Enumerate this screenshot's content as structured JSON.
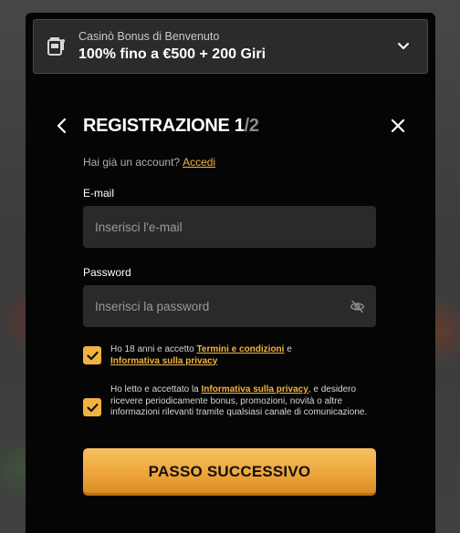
{
  "bonus": {
    "subtitle": "Casinò Bonus di Benvenuto",
    "title": "100% fino a €500 + 200 Giri",
    "icon": "slot-machine-icon"
  },
  "header": {
    "title_main": "REGISTRAZIONE 1",
    "title_total": "/2"
  },
  "login": {
    "prompt": "Hai già un account?",
    "link": "Accedi"
  },
  "email": {
    "label": "E-mail",
    "placeholder": "Inserisci l'e-mail",
    "value": ""
  },
  "password": {
    "label": "Password",
    "placeholder": "Inserisci la password",
    "value": ""
  },
  "consents": [
    {
      "checked": true,
      "text_before": "Ho 18 anni e accetto ",
      "link1": "Termini e condizioni",
      "text_middle": " e ",
      "link2": "Informativa sulla privacy",
      "text_after": ""
    },
    {
      "checked": true,
      "text_before": "Ho letto e accettato la ",
      "link1": "Informativa sulla privacy",
      "text_after": ", e desidero ricevere periodicamente bonus, promozioni, novità o altre informazioni rilevanti tramite qualsiasi canale di comunicazione."
    }
  ],
  "submit_label": "PASSO SUCCESSIVO",
  "colors": {
    "accent": "#f2b441",
    "modal_bg": "#050505",
    "field_bg": "#2a2a2a"
  }
}
